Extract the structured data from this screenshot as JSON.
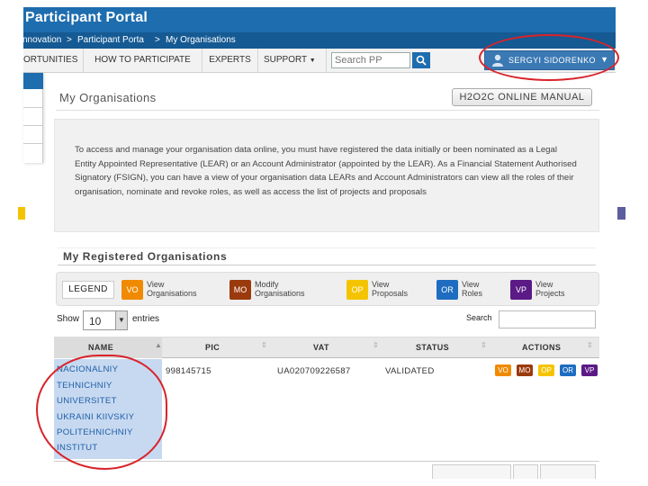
{
  "header": {
    "portal_title": "Participant Portal",
    "breadcrumb": [
      "nnovation",
      "Participant Porta",
      "My Organisations"
    ],
    "breadcrumb_sep": ">"
  },
  "nav": {
    "items": [
      "ORTUNITIES",
      "HOW TO PARTICIPATE",
      "EXPERTS",
      "SUPPORT"
    ],
    "support_caret": "▼",
    "search_placeholder": "Search PP",
    "search_icon": "search-icon",
    "user_name": "SERGYI SIDORENKO",
    "user_caret": "▼"
  },
  "page": {
    "title": "My Organisations",
    "manual_button": "H2O2C ONLINE MANUAL",
    "info_text": "To access and manage your organisation data online, you must have registered the data initially or been nominated as a Legal Entity Appointed Representative (LEAR) or an Account Administrator (appointed by the LEAR). As a Financial Statement Authorised Signatory (FSIGN), you can have a view of your organisation data LEARs and Account Administrators can view all the roles of their organisation, nominate and revoke roles, as well as access the list of projects and proposals"
  },
  "registered": {
    "title": "My Registered Organisations",
    "legend_label": "LEGEND",
    "legend": [
      {
        "code": "VO",
        "text": "View\nOrganisations",
        "color": "#f08a00"
      },
      {
        "code": "MO",
        "text": "Modify\nOrganisations",
        "color": "#9b3a0c"
      },
      {
        "code": "OP",
        "text": "View\nProposals",
        "color": "#f5c400"
      },
      {
        "code": "OR",
        "text": "View\nRoles",
        "color": "#1e6dc0"
      },
      {
        "code": "VP",
        "text": "View\nProjects",
        "color": "#5b1a86"
      }
    ]
  },
  "table": {
    "show_label": "Show",
    "show_value": "10",
    "show_caret": "▼",
    "entries_label": "entries",
    "search_label": "Search",
    "columns": [
      "NAME",
      "PIC",
      "VAT",
      "STATUS",
      "ACTIONS"
    ],
    "sort_icon": "⇕",
    "sort_up_icon": "▲",
    "rows": [
      {
        "name_lines": [
          "NACIONALNIY",
          "TEHNICHNIY",
          "UNIVERSITET",
          "UKRAINI KIIVSKIY",
          "POLITEHNICHNIY",
          "INSTITUT"
        ],
        "pic": "998145715",
        "vat": "UA020709226587",
        "status": "VALIDATED",
        "actions": [
          "VO",
          "MO",
          "OP",
          "OR",
          "VP"
        ]
      }
    ]
  },
  "colors": {
    "header_blue": "#1e6dae",
    "annotation_red": "#d9232a",
    "name_highlight": "#c7d9f0"
  }
}
